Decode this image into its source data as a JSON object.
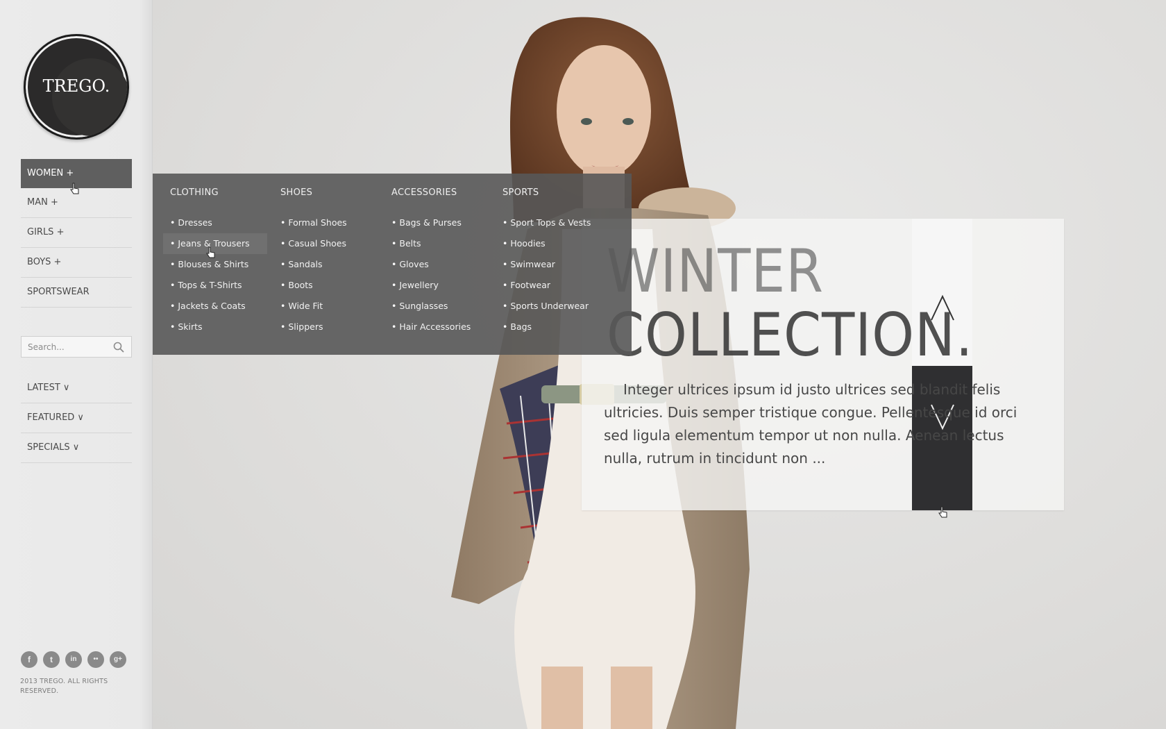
{
  "brand": {
    "logo_text": "TREGO."
  },
  "nav": [
    {
      "label": "WOMEN +",
      "active": true
    },
    {
      "label": "MAN +"
    },
    {
      "label": "GIRLS +"
    },
    {
      "label": "BOYS +"
    },
    {
      "label": "SPORTSWEAR"
    }
  ],
  "search": {
    "placeholder": "Search..."
  },
  "nav2": [
    {
      "label": "LATEST ∨"
    },
    {
      "label": "FEATURED ∨"
    },
    {
      "label": "SPECIALS ∨"
    }
  ],
  "social": [
    {
      "icon": "facebook-icon",
      "glyph": "f"
    },
    {
      "icon": "twitter-icon",
      "glyph": "t"
    },
    {
      "icon": "linkedin-icon",
      "glyph": "in"
    },
    {
      "icon": "flickr-icon",
      "glyph": "••"
    },
    {
      "icon": "google-plus-icon",
      "glyph": "g+"
    }
  ],
  "footer": {
    "copyright": "2013 TREGO. ALL RIGHTS RESERVED."
  },
  "megamenu": {
    "columns": [
      {
        "title": "CLOTHING",
        "items": [
          "Dresses",
          "Jeans & Trousers",
          "Blouses & Shirts",
          "Tops & T-Shirts",
          "Jackets & Coats",
          "Skirts"
        ]
      },
      {
        "title": "SHOES",
        "items": [
          "Formal Shoes",
          "Casual Shoes",
          "Sandals",
          "Boots",
          "Wide Fit",
          "Slippers"
        ]
      },
      {
        "title": "ACCESSORIES",
        "items": [
          "Bags & Purses",
          "Belts",
          "Gloves",
          "Jewellery",
          "Sunglasses",
          "Hair Accessories"
        ]
      },
      {
        "title": "SPORTS",
        "items": [
          "Sport Tops & Vests",
          "Hoodies",
          "Swimwear",
          "Footwear",
          "Sports Underwear",
          "Bags"
        ]
      }
    ],
    "hovered_item": "Jeans & Trousers"
  },
  "slide": {
    "title_line1": "WINTER",
    "title_line2": "COLLECTION.",
    "text": "Integer ultrices ipsum id justo ultrices sed blandit felis ultricies. Duis semper tristique congue. Pellentesque id orci sed ligula elementum tempor ut non nulla. Aenean lectus nulla, rutrum in tincidunt non ...",
    "up_icon": "chevron-up-icon",
    "down_icon": "chevron-down-icon"
  },
  "colors": {
    "sidebar_bg": "#ebebeb",
    "nav_active_bg": "#5f5f5f",
    "megamenu_bg": "#585858",
    "arrow_dark": "#2f2f31",
    "logo_bg": "#2b2a2a"
  }
}
